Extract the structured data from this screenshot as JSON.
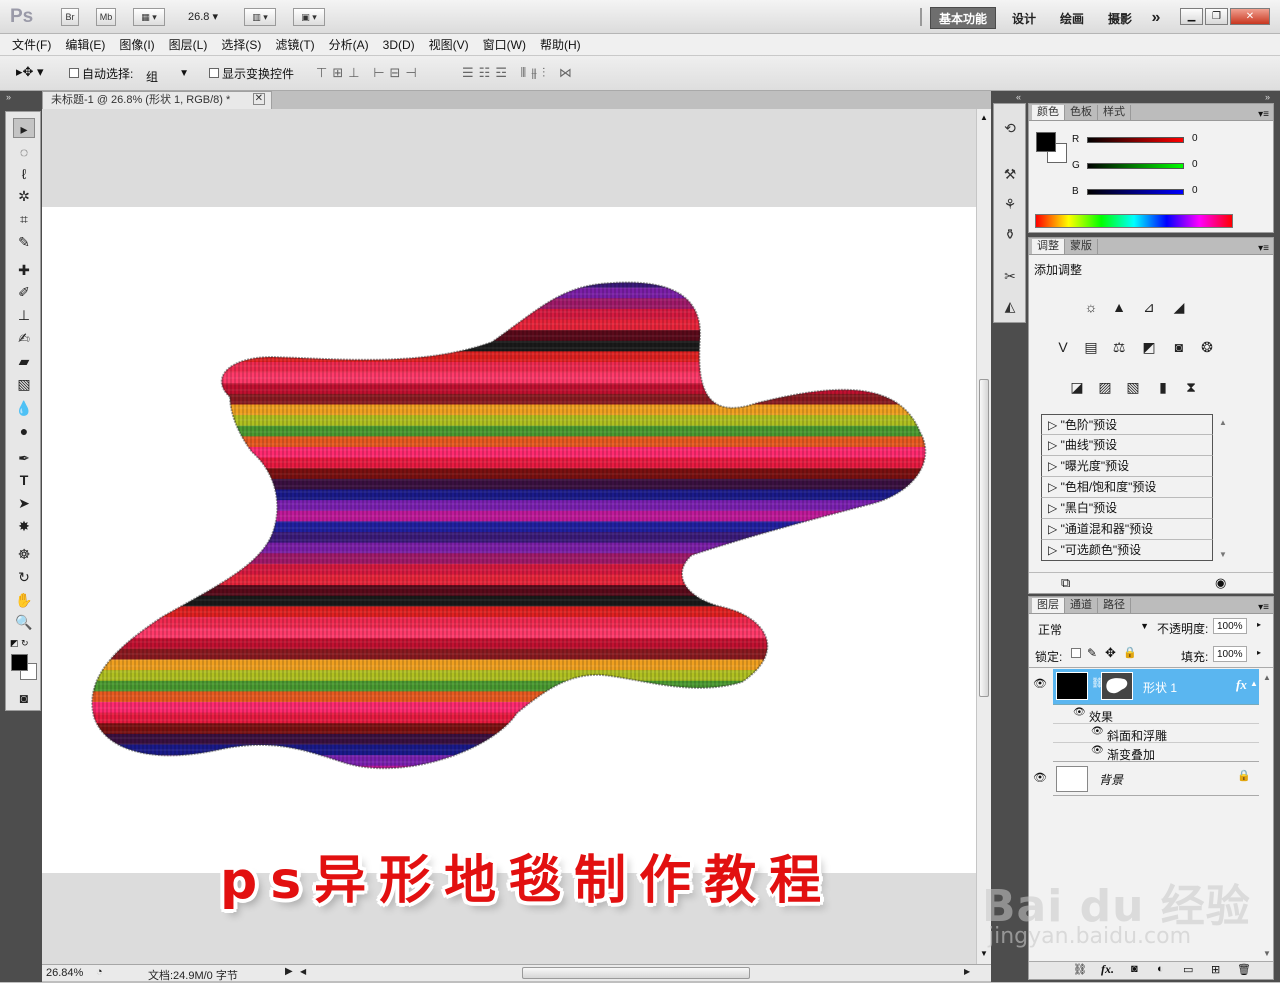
{
  "app": {
    "logo": "Ps",
    "br_label": "Br",
    "mb_label": "Mb",
    "zoom_value": "26.8",
    "workspaces": [
      "基本功能",
      "设计",
      "绘画",
      "摄影"
    ],
    "more_label": "»"
  },
  "menu": [
    "文件(F)",
    "编辑(E)",
    "图像(I)",
    "图层(L)",
    "选择(S)",
    "滤镜(T)",
    "分析(A)",
    "3D(D)",
    "视图(V)",
    "窗口(W)",
    "帮助(H)"
  ],
  "options": {
    "auto_select_label": "自动选择:",
    "auto_select_value": "组",
    "show_transform_label": "显示变换控件"
  },
  "document": {
    "tab_title": "未标题-1 @ 26.8% (形状 1, RGB/8) *",
    "zoom_status": "26.84%",
    "doc_info": "文档:24.9M/0 字节",
    "caption": "ps异形地毯制作教程"
  },
  "color_panel": {
    "tabs": [
      "颜色",
      "色板",
      "样式"
    ],
    "r_label": "R",
    "r_value": "0",
    "g_label": "G",
    "g_value": "0",
    "b_label": "B",
    "b_value": "0"
  },
  "adjust_panel": {
    "tabs": [
      "调整",
      "蒙版"
    ],
    "heading": "添加调整",
    "presets": [
      "\"色阶\"预设",
      "\"曲线\"预设",
      "\"曝光度\"预设",
      "\"色相/饱和度\"预设",
      "\"黑白\"预设",
      "\"通道混和器\"预设",
      "\"可选颜色\"预设"
    ]
  },
  "layers_panel": {
    "tabs": [
      "图层",
      "通道",
      "路径"
    ],
    "blend_mode": "正常",
    "opacity_label": "不透明度:",
    "opacity_value": "100%",
    "lock_label": "锁定:",
    "fill_label": "填充:",
    "fill_value": "100%",
    "layer1_name": "形状 1",
    "fx_label": "fx",
    "effects_label": "效果",
    "effect1": "斜面和浮雕",
    "effect2": "渐变叠加",
    "bg_name": "背景"
  },
  "watermark": {
    "brand": "Bai du 经验",
    "url": "jingyan.baidu.com"
  },
  "colors": {
    "accent_selected": "#5ab6f0",
    "caption_red": "#e21010"
  },
  "carpet_stripes": [
    "#3a1a7a",
    "#7b1fa8",
    "#a01a6a",
    "#d61a40",
    "#e8243a",
    "#5a0a1a",
    "#1a1a1a",
    "#e02020",
    "#f02a50",
    "#ff3a6a",
    "#c21030",
    "#8a1a20",
    "#f0a020",
    "#b0c020",
    "#4a9a30",
    "#e85a20",
    "#ff2a70",
    "#e81a40",
    "#7a1010",
    "#3a1040",
    "#1a1a8a",
    "#7a20b0",
    "#c01a9a",
    "#2020a0"
  ]
}
